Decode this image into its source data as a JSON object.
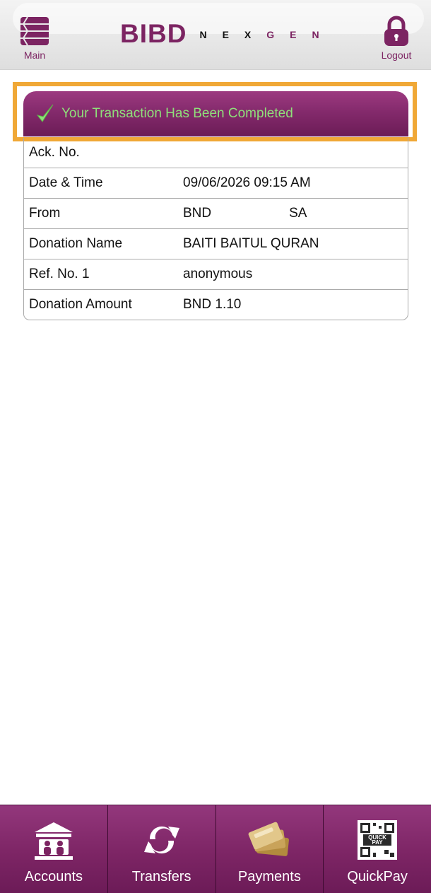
{
  "header": {
    "main_label": "Main",
    "brand": "BIBD",
    "brand_sub": "N E X G E N",
    "logout_label": "Logout",
    "accent_color": "#7c2462"
  },
  "banner": {
    "message": "Your Transaction Has Been Completed"
  },
  "details": [
    {
      "label": "Ack. No.",
      "value": "",
      "value2": ""
    },
    {
      "label": "Date & Time",
      "value": "09/06/2026 09:15 AM",
      "value2": ""
    },
    {
      "label": "From",
      "value": "BND",
      "value2": "SA"
    },
    {
      "label": "Donation Name",
      "value": "BAITI BAITUL QURAN",
      "value2": ""
    },
    {
      "label": "Ref. No. 1",
      "value": "anonymous",
      "value2": ""
    },
    {
      "label": "Donation Amount",
      "value": "BND 1.10",
      "value2": ""
    }
  ],
  "bottom_nav": [
    {
      "label": "Accounts",
      "icon": "bank-icon"
    },
    {
      "label": "Transfers",
      "icon": "refresh-arrows-icon"
    },
    {
      "label": "Payments",
      "icon": "cards-icon"
    },
    {
      "label": "QuickPay",
      "icon": "qr-code-icon"
    }
  ]
}
